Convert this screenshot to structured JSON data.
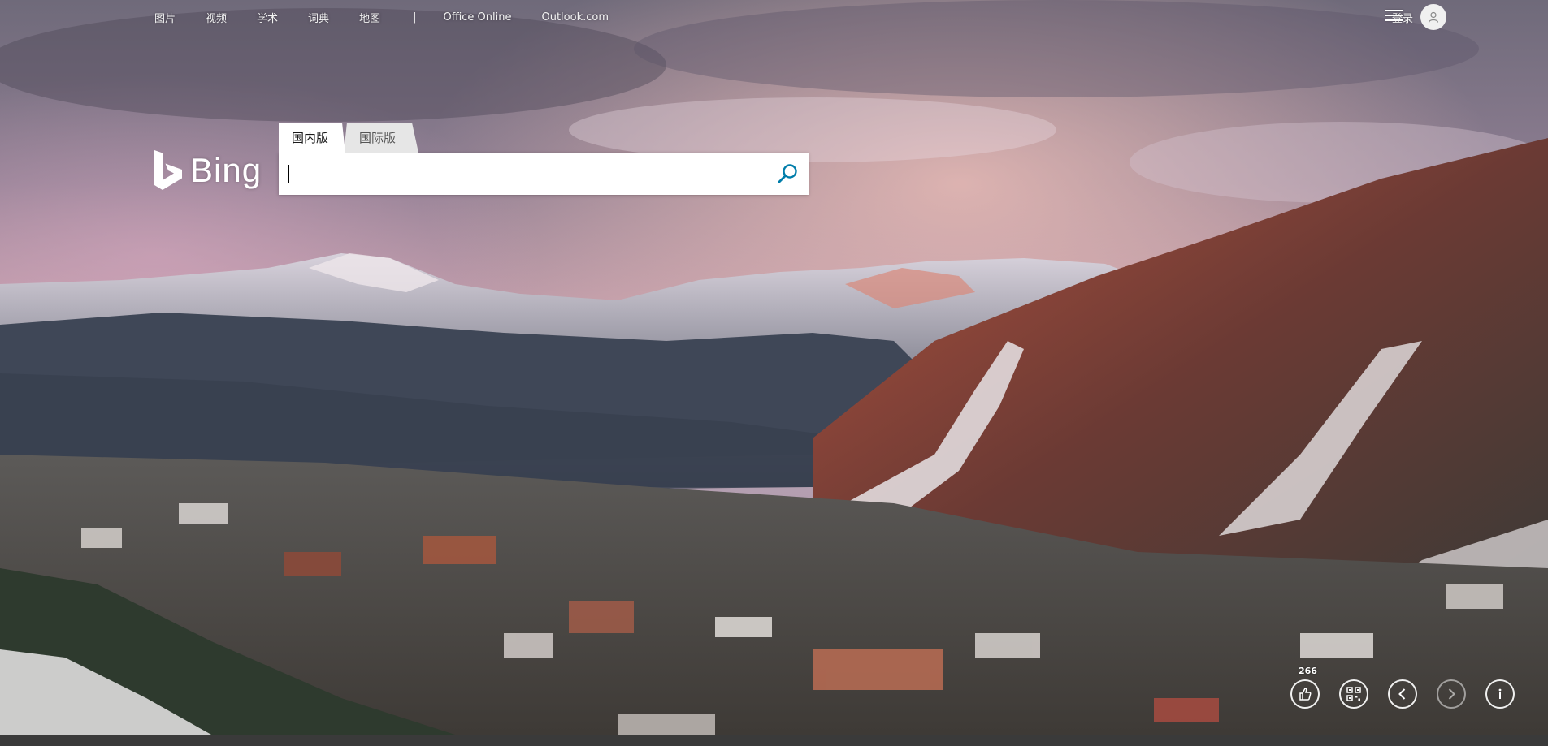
{
  "nav": {
    "items": [
      "图片",
      "视频",
      "学术",
      "词典",
      "地图"
    ],
    "separator": "|",
    "links": [
      "Office Online",
      "Outlook.com"
    ]
  },
  "header": {
    "login_label": "登录",
    "avatar_icon": "user-avatar-icon",
    "menu_icon": "hamburger-menu-icon"
  },
  "logo": {
    "text": "Bing"
  },
  "search": {
    "tabs": [
      {
        "label": "国内版",
        "active": true
      },
      {
        "label": "国际版",
        "active": false
      }
    ],
    "value": "",
    "placeholder": "",
    "button_icon": "search-icon"
  },
  "controls": {
    "like_count": "266",
    "buttons": [
      {
        "name": "like-icon"
      },
      {
        "name": "qr-code-icon"
      },
      {
        "name": "previous-image-icon"
      },
      {
        "name": "next-image-icon"
      },
      {
        "name": "info-icon"
      }
    ]
  },
  "colors": {
    "search_accent": "#007daa",
    "tab_active_bg": "#ffffff",
    "tab_inactive_bg": "#e6e6e6"
  }
}
